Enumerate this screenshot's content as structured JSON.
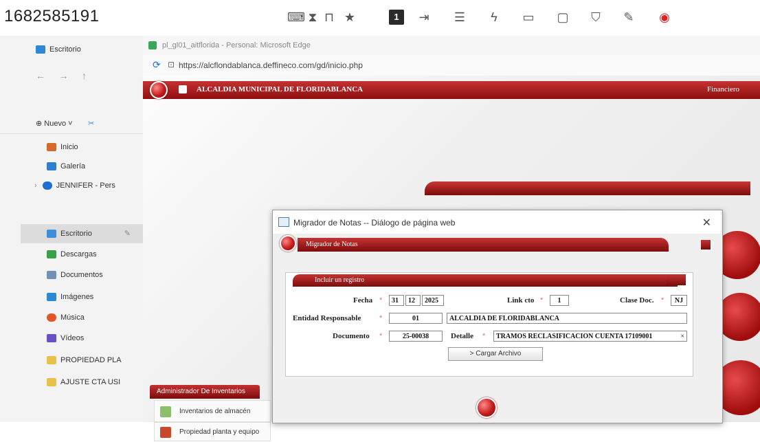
{
  "topbar": {
    "session_id": "1682585191",
    "icons": [
      "translate-icon",
      "timer-icon",
      "lock-icon",
      "star-icon",
      "one-badge-icon",
      "exit-icon",
      "notes-icon",
      "flash-icon",
      "keyboard-icon",
      "monitor-icon",
      "shield-icon",
      "pen-icon",
      "record-icon"
    ],
    "badge_label": "1"
  },
  "explorer": {
    "desktop_label": "Escritorio",
    "new_label": "Nuevo",
    "items": [
      {
        "label": "Inicio",
        "color": "#d46a2c"
      },
      {
        "label": "Galería",
        "color": "#2f7fd1"
      },
      {
        "label": "JENNIFER - Pers",
        "color": "#1f6fd0"
      },
      {
        "label": "Escritorio",
        "color": "#3c8edb"
      },
      {
        "label": "Descargas",
        "color": "#3aa04a"
      },
      {
        "label": "Documentos",
        "color": "#7590b5"
      },
      {
        "label": "Imágenes",
        "color": "#2e88d8"
      },
      {
        "label": "Música",
        "color": "#e0582a"
      },
      {
        "label": "Vídeos",
        "color": "#6a4fc7"
      },
      {
        "label": "PROPIEDAD PLA",
        "color": "#e8c04a"
      },
      {
        "label": "AJUSTE CTA USI",
        "color": "#e8c04a"
      }
    ]
  },
  "browser": {
    "title": "pl_gl01_aitflorida - Personal: Microsoft Edge",
    "url": "https://alcflondablanca.deffineco.com/gd/inicio.php"
  },
  "app": {
    "title": "ALCALDIA MUNICIPAL DE FLORIDABLANCA",
    "module": "Financiero",
    "inventory_header": "Administrador De Inventarios",
    "inventory_items": [
      "Inventarios de almacén",
      "Propiedad planta y equipo"
    ]
  },
  "dialog": {
    "title": "Migrador de Notas -- Diálogo de página web",
    "section_title": "Migrador de Notas",
    "form_title": "Incluir un registro",
    "required_mark": "*",
    "fecha_label": "Fecha",
    "fecha_day": "31",
    "fecha_month": "12",
    "fecha_year": "2025",
    "link_label": "Link cto",
    "link_value": "1",
    "clase_label": "Clase Doc.",
    "clase_value": "NJ",
    "entidad_label": "Entidad Responsable",
    "entidad_code": "01",
    "entidad_name": "ALCALDIA DE FLORIDABLANCA",
    "documento_label": "Documento",
    "documento_value": "25-00038",
    "detalle_label": "Detalle",
    "detalle_value": "TRAMOS RECLASIFICACION CUENTA 17109001",
    "cargar_label": "> Cargar Archivo"
  }
}
